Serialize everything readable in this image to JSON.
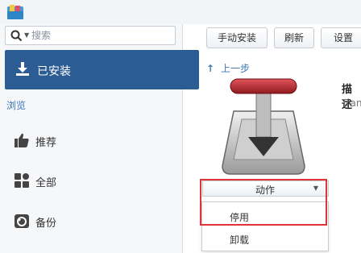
{
  "sidebar": {
    "search_placeholder": "搜索",
    "active_item": "已安装",
    "section_label": "浏览",
    "items": [
      {
        "label": "推荐",
        "icon": "thumbs-up-icon"
      },
      {
        "label": "全部",
        "icon": "grid-icon"
      },
      {
        "label": "备份",
        "icon": "backup-icon"
      }
    ]
  },
  "toolbar": {
    "manual_install": "手动安装",
    "refresh": "刷新",
    "settings": "设置"
  },
  "content": {
    "back_label": "上一步",
    "description_title": "描述",
    "description_text": "Trans web"
  },
  "action_menu": {
    "button_label": "动作",
    "items": [
      "停用",
      "卸载"
    ]
  },
  "colors": {
    "nav_active": "#2b5d94",
    "link": "#3d76b5",
    "highlight": "#e0333a"
  }
}
